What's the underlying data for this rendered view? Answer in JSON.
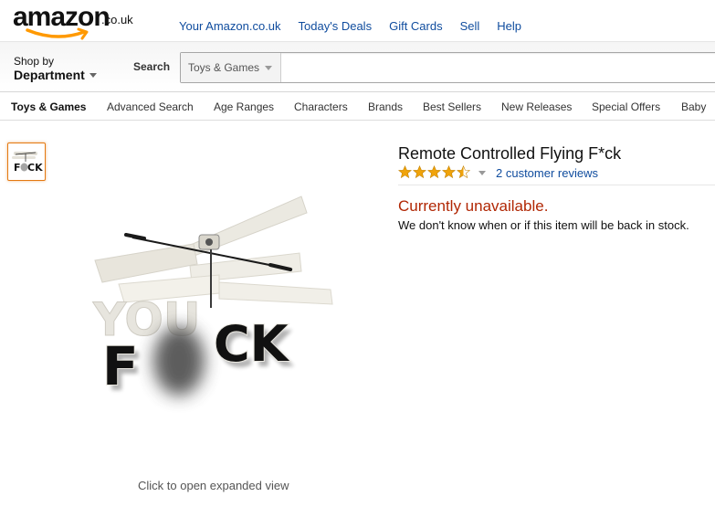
{
  "header": {
    "logo_word": "amazon",
    "logo_tld": ".co.uk",
    "nav": [
      "Your Amazon.co.uk",
      "Today's Deals",
      "Gift Cards",
      "Sell",
      "Help"
    ]
  },
  "search": {
    "shop_by_small": "Shop by",
    "shop_by_big": "Department",
    "label": "Search",
    "department": "Toys & Games",
    "value": ""
  },
  "subnav": [
    "Toys & Games",
    "Advanced Search",
    "Age Ranges",
    "Characters",
    "Brands",
    "Best Sellers",
    "New Releases",
    "Special Offers",
    "Baby"
  ],
  "product": {
    "title": "Remote Controlled Flying F*ck",
    "rating": 4.5,
    "rating_max": 5,
    "reviews": "2 customer reviews",
    "availability": "Currently unavailable.",
    "availability_note": "We don't know when or if this item will be back in stock.",
    "image_letters": "F CK",
    "expand_text": "Click to open expanded view"
  },
  "colors": {
    "link": "#0f4c9e",
    "unavailable": "#b12704",
    "star": "#f0a30a",
    "thumb_border": "#e47911",
    "logo_smile": "#ff9900"
  }
}
